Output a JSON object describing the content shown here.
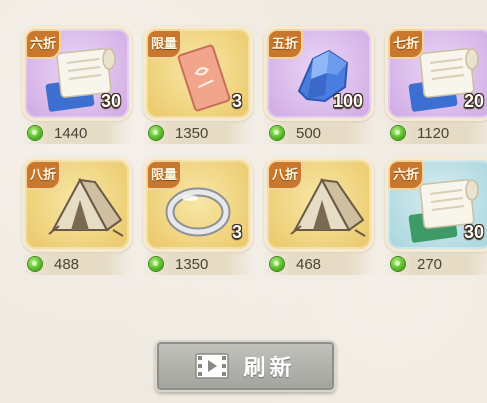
{
  "shop_items": [
    {
      "badge": "六折",
      "quantity": "30",
      "price": "1440",
      "rarity": "purple",
      "icon": "scroll-icon"
    },
    {
      "badge": "限量",
      "quantity": "3",
      "price": "1350",
      "rarity": "gold",
      "icon": "talisman-card-icon"
    },
    {
      "badge": "五折",
      "quantity": "100",
      "price": "500",
      "rarity": "purple",
      "icon": "blue-crystal-icon"
    },
    {
      "badge": "七折",
      "quantity": "20",
      "price": "1120",
      "rarity": "purple",
      "icon": "scroll-icon"
    },
    {
      "badge": "八折",
      "quantity": "",
      "price": "488",
      "rarity": "gold",
      "icon": "tent-icon"
    },
    {
      "badge": "限量",
      "quantity": "3",
      "price": "1350",
      "rarity": "gold",
      "icon": "silver-ring-icon"
    },
    {
      "badge": "八折",
      "quantity": "",
      "price": "468",
      "rarity": "gold",
      "icon": "tent-icon"
    },
    {
      "badge": "六折",
      "quantity": "30",
      "price": "270",
      "rarity": "blue",
      "icon": "scroll-icon"
    }
  ],
  "currency_icon": "green-jade-coin-icon",
  "refresh_button": {
    "label": "刷新",
    "icon": "film-video-icon"
  },
  "colors": {
    "badge": "#c9772c",
    "purple_card": "#cfa8e4",
    "gold_card": "#eac767",
    "blue_card": "#a6d4dd",
    "button": "#b3b2ad"
  }
}
